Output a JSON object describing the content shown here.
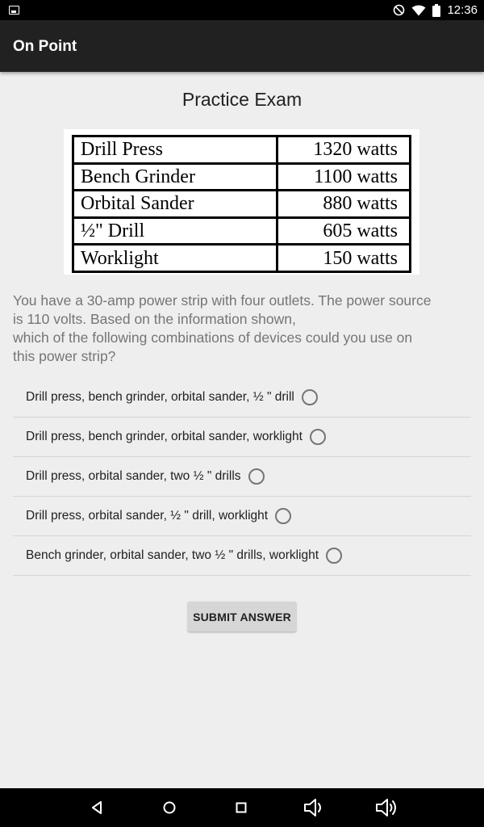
{
  "status_bar": {
    "time": "12:36",
    "icons": [
      "image-icon",
      "do-not-disturb-icon",
      "wifi-icon",
      "battery-icon"
    ]
  },
  "app_bar": {
    "title": "On Point"
  },
  "page": {
    "title": "Practice Exam"
  },
  "wattage_table": {
    "rows": [
      {
        "device": "Drill Press",
        "watts": "1320 watts"
      },
      {
        "device": "Bench Grinder",
        "watts": "1100 watts"
      },
      {
        "device": "Orbital Sander",
        "watts": "880 watts"
      },
      {
        "device": "½\" Drill",
        "watts": "605 watts"
      },
      {
        "device": "Worklight",
        "watts": "150 watts"
      }
    ]
  },
  "question": {
    "lines": [
      "You have a 30-amp power strip with four outlets. The power source",
      "is 110 volts. Based on the information shown,",
      "which of the following combinations of devices could you use on",
      "this power strip?"
    ]
  },
  "options": [
    {
      "label": "Drill press, bench grinder, orbital sander, ½ \" drill",
      "selected": false
    },
    {
      "label": "Drill press, bench grinder, orbital sander, worklight",
      "selected": false
    },
    {
      "label": "Drill press, orbital sander, two ½ \" drills",
      "selected": false
    },
    {
      "label": "Drill press, orbital sander, ½ \" drill, worklight",
      "selected": false
    },
    {
      "label": "Bench grinder, orbital sander, two ½ \" drills, worklight",
      "selected": false
    }
  ],
  "submit": {
    "label": "SUBMIT ANSWER"
  },
  "nav_bar": {
    "icons": [
      "back-icon",
      "home-icon",
      "recents-icon",
      "volume-down-icon",
      "volume-up-icon"
    ]
  }
}
